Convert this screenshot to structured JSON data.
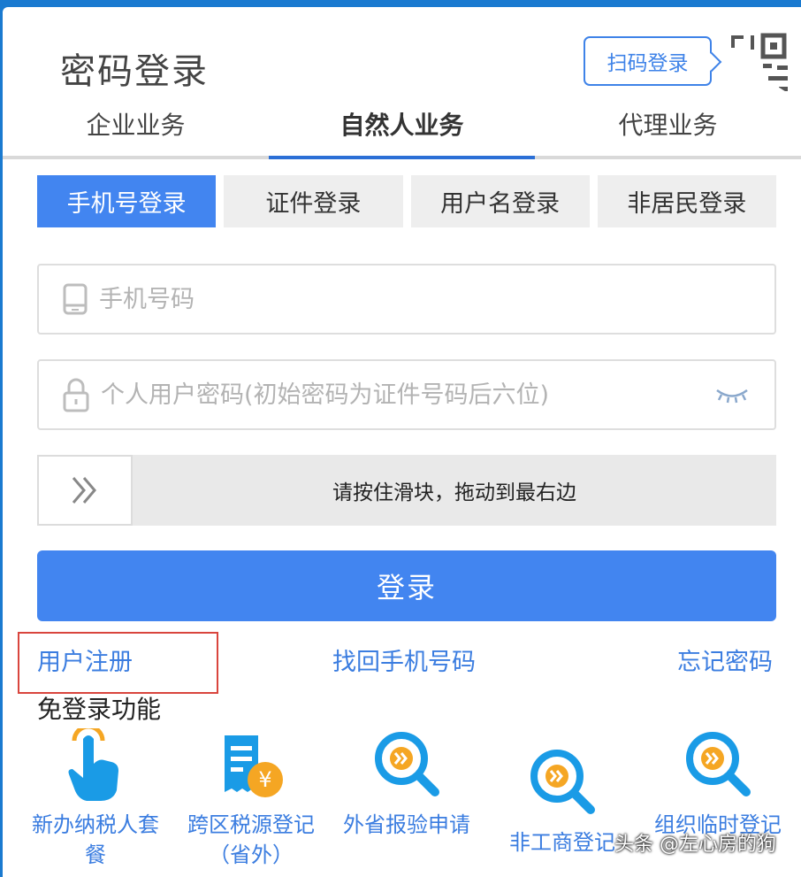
{
  "page": {
    "title": "密码登录",
    "scan_login": "扫码登录"
  },
  "top_tabs": [
    {
      "label": "企业业务",
      "active": false
    },
    {
      "label": "自然人业务",
      "active": true
    },
    {
      "label": "代理业务",
      "active": false
    }
  ],
  "sub_tabs": [
    {
      "label": "手机号登录",
      "active": true
    },
    {
      "label": "证件登录",
      "active": false
    },
    {
      "label": "用户名登录",
      "active": false
    },
    {
      "label": "非居民登录",
      "active": false
    }
  ],
  "form": {
    "phone_placeholder": "手机号码",
    "password_placeholder": "个人用户密码(初始密码为证件号码后六位)",
    "slider_text": "请按住滑块，拖动到最右边",
    "login_label": "登录"
  },
  "links": {
    "register": "用户注册",
    "recover_phone": "找回手机号码",
    "forgot_password": "忘记密码"
  },
  "no_login": {
    "title": "免登录功能",
    "items": [
      {
        "label": "新办纳税人套餐",
        "icon": "hand-tap-icon"
      },
      {
        "label": "跨区税源登记（省外）",
        "icon": "receipt-yuan-icon"
      },
      {
        "label": "外省报验申请",
        "icon": "search-magnifier-icon"
      },
      {
        "label": "非工商登记",
        "icon": "search-magnifier-icon"
      },
      {
        "label": "组织临时登记",
        "icon": "search-magnifier-icon"
      }
    ]
  },
  "watermark": "头条 @左心房的狗",
  "colors": {
    "primary": "#4285f0",
    "link": "#3b7de0",
    "highlight_box": "#d9453d"
  }
}
